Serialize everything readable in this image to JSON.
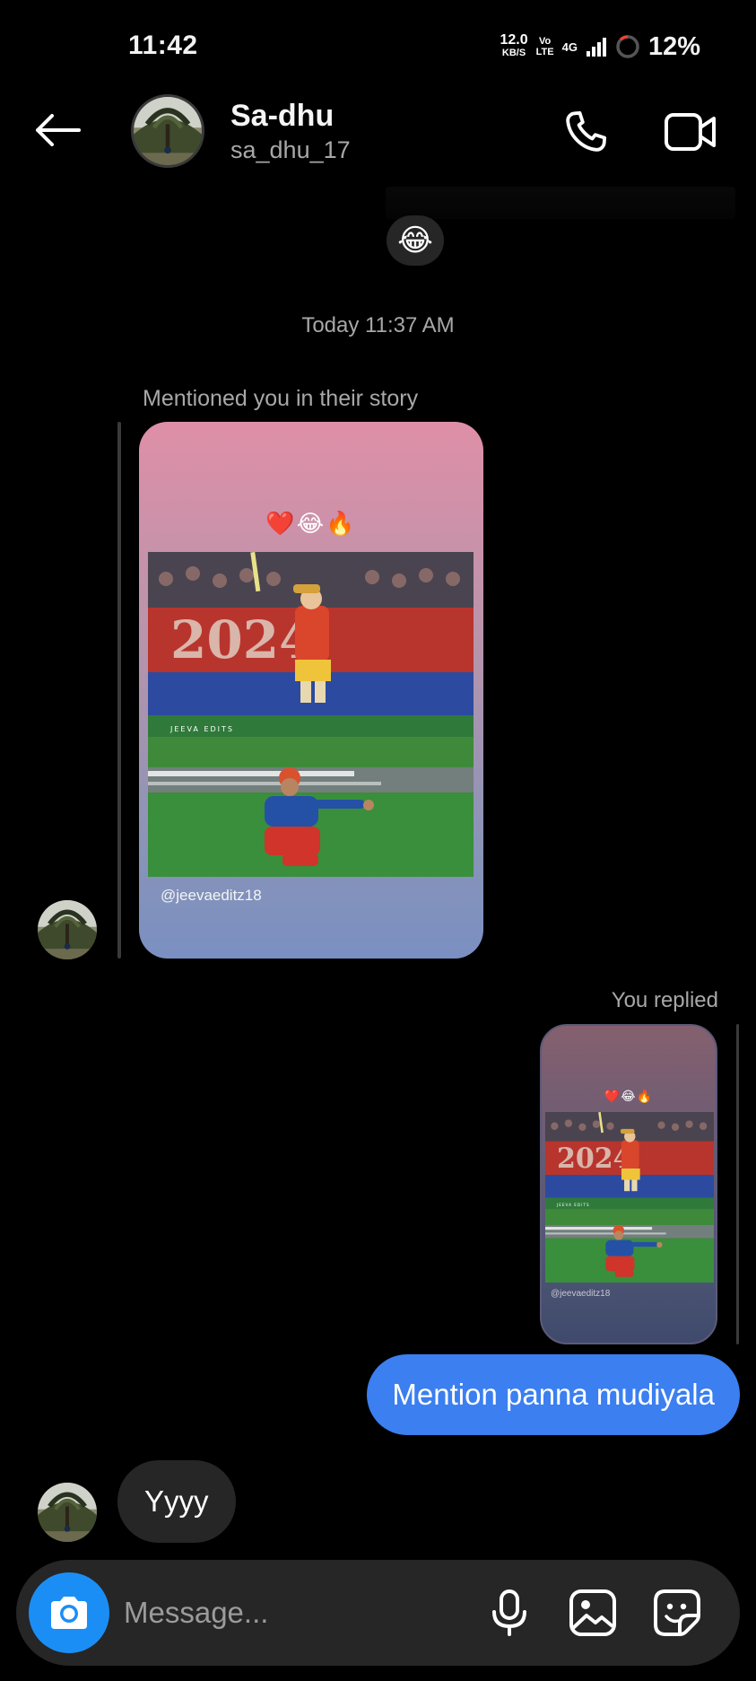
{
  "status_bar": {
    "time": "11:42",
    "net_speed_value": "12.0",
    "net_speed_unit": "KB/S",
    "volte": "Vo LTE",
    "network": "4G",
    "battery": "12%"
  },
  "header": {
    "name": "Sa-dhu",
    "username": "sa_dhu_17"
  },
  "conversation": {
    "reaction_emoji": "😂",
    "timestamp": "Today 11:37 AM",
    "story_mention": {
      "caption": "Mentioned you in their story",
      "emojis": "❤️😂🔥",
      "credit": "@jeevaeditz18"
    },
    "reply": {
      "caption": "You replied",
      "emojis": "❤️😂🔥",
      "credit": "@jeevaeditz18",
      "message": "Mention panna mudiyala"
    },
    "incoming_message": "Yyyy"
  },
  "composer": {
    "placeholder": "Message..."
  },
  "colors": {
    "background": "#000000",
    "outgoing_bubble": "#3b7ff0",
    "incoming_bubble": "#262626",
    "camera_button": "#1b8ef5",
    "secondary_text": "#a8a8a8"
  },
  "icons": [
    "back-arrow-icon",
    "phone-icon",
    "video-camera-icon",
    "camera-icon",
    "microphone-icon",
    "gallery-icon",
    "sticker-icon"
  ]
}
